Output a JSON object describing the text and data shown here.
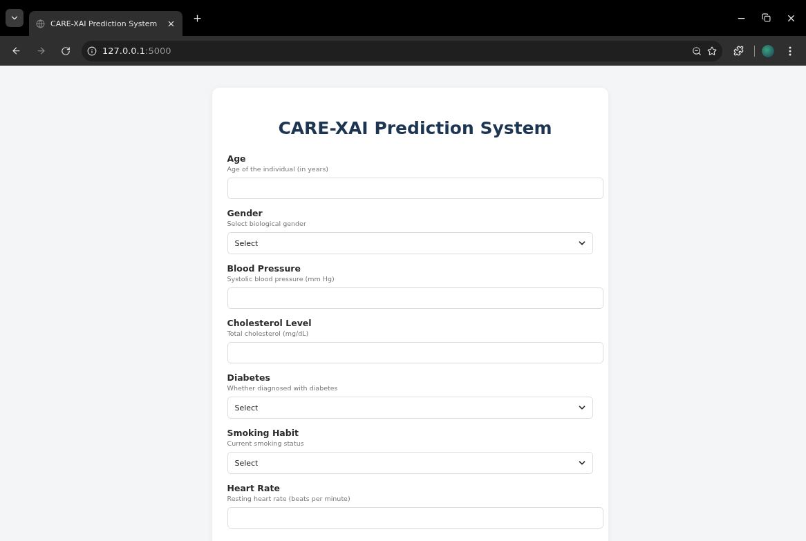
{
  "browser": {
    "tab": {
      "title": "CARE-XAI Prediction System",
      "selected": true
    },
    "address": {
      "host": "127.0.0.1",
      "port": ":5000"
    }
  },
  "form": {
    "title": "CARE-XAI Prediction System",
    "fields": [
      {
        "kind": "text",
        "label": "Age",
        "hint": "Age of the individual (in years)"
      },
      {
        "kind": "select",
        "label": "Gender",
        "hint": "Select biological gender",
        "value": "Select"
      },
      {
        "kind": "text",
        "label": "Blood Pressure",
        "hint": "Systolic blood pressure (mm Hg)"
      },
      {
        "kind": "text",
        "label": "Cholesterol Level",
        "hint": "Total cholesterol (mg/dL)"
      },
      {
        "kind": "select",
        "label": "Diabetes",
        "hint": "Whether diagnosed with diabetes",
        "value": "Select"
      },
      {
        "kind": "select",
        "label": "Smoking Habit",
        "hint": "Current smoking status",
        "value": "Select"
      },
      {
        "kind": "text",
        "label": "Heart Rate",
        "hint": "Resting heart rate (beats per minute)"
      }
    ]
  }
}
